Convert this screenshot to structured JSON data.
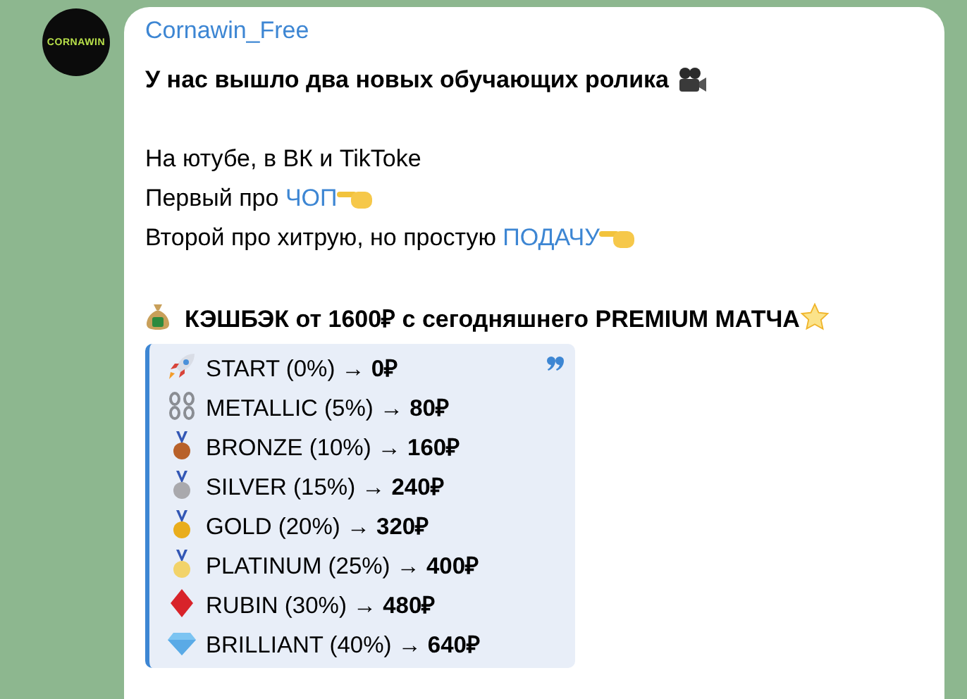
{
  "channel": {
    "name": "Cornawin_Free",
    "avatar_text": "CORNAWIN"
  },
  "message": {
    "lines": [
      {
        "kind": "title",
        "text": "У нас вышло два новых обучающих ролика"
      },
      {
        "kind": "gap"
      },
      {
        "kind": "plain",
        "text": "На ютубе, в ВК и TikToke"
      },
      {
        "kind": "link",
        "text": "Первый про ",
        "link": "ЧОП"
      },
      {
        "kind": "link",
        "text": "Второй про хитрую, но простую ",
        "link": "ПОДАЧУ"
      },
      {
        "kind": "gap"
      },
      {
        "kind": "offer",
        "text": "КЭШБЭК от 1600₽ с сегодняшнего PREMIUM МАТЧА"
      }
    ],
    "quote": [
      {
        "kind": "rocket",
        "text": "START (0%) → **0₽**"
      },
      {
        "kind": "chain",
        "text": "METALLIC (5%) → **80₽**"
      },
      {
        "kind": "medal",
        "color": "#b8612a",
        "text": "BRONZE (10%) → **160₽**"
      },
      {
        "kind": "medal",
        "color": "#a9a9ad",
        "text": "SILVER (15%) → **240₽**"
      },
      {
        "kind": "medal",
        "color": "#e9ad1c",
        "text": "GOLD (20%) → **320₽**"
      },
      {
        "kind": "medal",
        "color": "#f2d36a",
        "text": "PLATINUM (25%) → **400₽**"
      },
      {
        "kind": "ruby",
        "text": "RUBIN (30%) → **480₽**"
      },
      {
        "kind": "gem",
        "text": "BRILLIANT (40%) → **640₽**"
      }
    ]
  }
}
